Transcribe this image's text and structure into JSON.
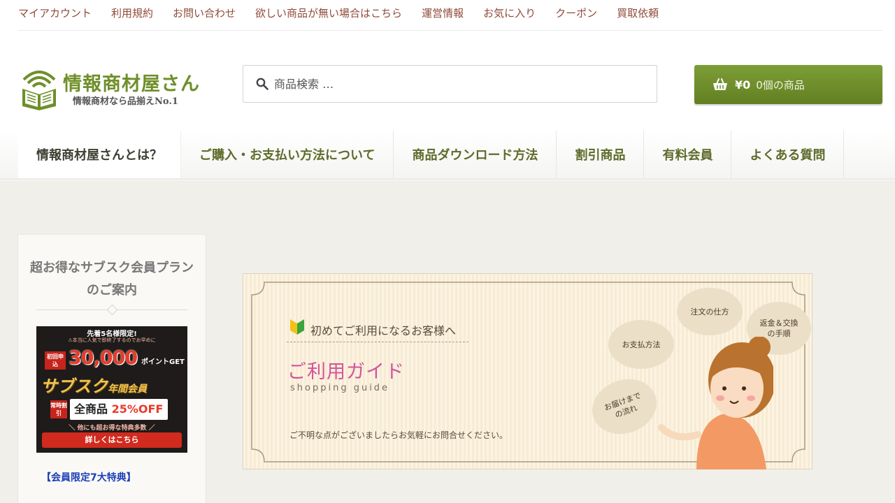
{
  "top_nav": {
    "items": [
      "マイアカウント",
      "利用規約",
      "お問い合わせ",
      "欲しい商品が無い場合はこちら",
      "運営情報",
      "お気に入り",
      "クーポン",
      "買取依頼"
    ]
  },
  "logo": {
    "name": "情報商材屋さん",
    "tagline": "情報商材なら品揃えNo.1"
  },
  "search": {
    "placeholder": "商品検索 …",
    "icon": "search-icon"
  },
  "cart": {
    "amount": "¥0",
    "count_text": "0個の商品",
    "icon": "basket-icon"
  },
  "main_nav": {
    "items": [
      "情報商材屋さんとは？",
      "ご購入・お支払い方法について",
      "商品ダウンロード方法",
      "割引商品",
      "有料会員",
      "よくある質問"
    ]
  },
  "sidebar": {
    "title": "超お得なサブスク会員プランのご案内",
    "banner": {
      "top": "先着5名様限定!",
      "sub": "⚠本当に人気で即終了するのでお早めに",
      "points_label": "初回申込",
      "points": "30,000",
      "points_tail": "ポイントGET",
      "plan": "サブスク",
      "plan_suffix": "年間会員",
      "discount_label": "常時割引",
      "discount_prefix": "全商品",
      "discount_value": "25%OFF",
      "other": "＼ 他にも超お得な特典多数 ／",
      "button": "詳しくはこちら"
    },
    "bonus_link": "【会員限定7大特典】"
  },
  "guide_banner": {
    "welcome": "初めてご利用になるお客様へ",
    "title": "ご利用ガイド",
    "subtitle": "shopping guide",
    "note": "ご不明な点がございましたらお気軽にお問合せください。",
    "bubbles": {
      "payment": "お支払方法",
      "order": "注文の仕方",
      "return": "返金＆交換の手順",
      "delivery": "お届けまでの流れ"
    }
  },
  "colors": {
    "accent_green": "#6f8f2a",
    "top_link": "#8f4b3a",
    "guide_pink": "#d2559a",
    "bonus_blue": "#1a3eb8"
  }
}
